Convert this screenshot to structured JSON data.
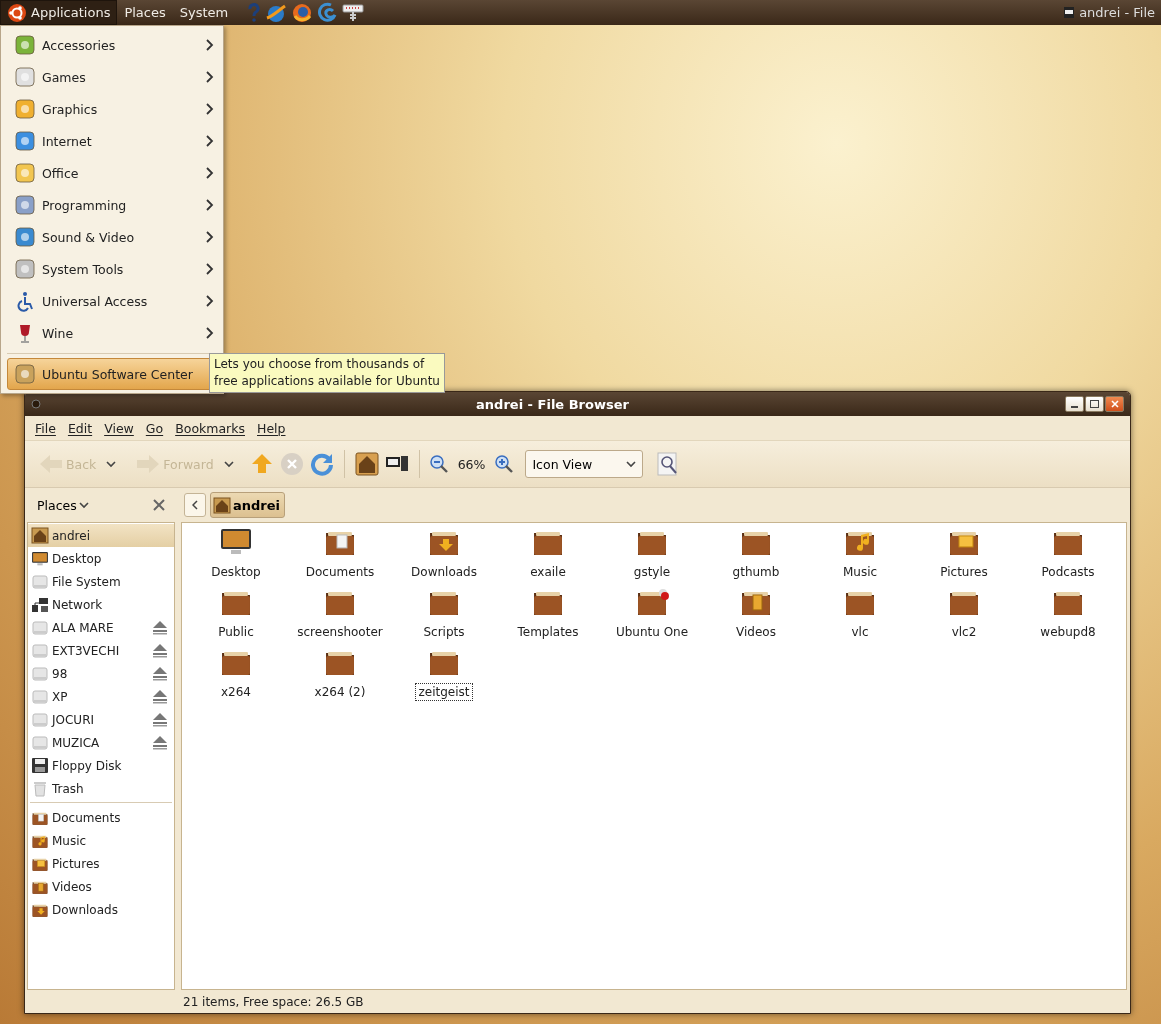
{
  "top_panel": {
    "menus": [
      {
        "label": "Applications",
        "selected": true
      },
      {
        "label": "Places",
        "selected": false
      },
      {
        "label": "System",
        "selected": false
      }
    ],
    "window_button": {
      "label": "andrei - File"
    }
  },
  "applications_menu": {
    "items": [
      {
        "label": "Accessories",
        "kind": "accessories",
        "submenu": true,
        "selected": false
      },
      {
        "label": "Games",
        "kind": "games",
        "submenu": true,
        "selected": false
      },
      {
        "label": "Graphics",
        "kind": "graphics",
        "submenu": true,
        "selected": false
      },
      {
        "label": "Internet",
        "kind": "internet",
        "submenu": true,
        "selected": false
      },
      {
        "label": "Office",
        "kind": "office",
        "submenu": true,
        "selected": false
      },
      {
        "label": "Programming",
        "kind": "programming",
        "submenu": true,
        "selected": false
      },
      {
        "label": "Sound & Video",
        "kind": "sound",
        "submenu": true,
        "selected": false
      },
      {
        "label": "System Tools",
        "kind": "tools",
        "submenu": true,
        "selected": false
      },
      {
        "label": "Universal Access",
        "kind": "access",
        "submenu": true,
        "selected": false
      },
      {
        "label": "Wine",
        "kind": "wine",
        "submenu": true,
        "selected": false
      }
    ],
    "footer_items": [
      {
        "label": "Ubuntu Software Center",
        "kind": "software",
        "submenu": false,
        "selected": true
      }
    ],
    "tooltip": "Lets you choose from thousands of\nfree applications available for Ubuntu"
  },
  "window": {
    "title": "andrei - File Browser",
    "menubar": [
      "File",
      "Edit",
      "View",
      "Go",
      "Bookmarks",
      "Help"
    ],
    "toolbar": {
      "back": {
        "label": "Back",
        "disabled": true
      },
      "forward": {
        "label": "Forward",
        "disabled": true
      },
      "zoom": "66%",
      "view": "Icon View"
    },
    "sidebar": {
      "header": "Places",
      "places": [
        {
          "label": "andrei",
          "kind": "home",
          "ejectable": false,
          "selected": true
        },
        {
          "label": "Desktop",
          "kind": "desktop",
          "ejectable": false,
          "selected": false
        },
        {
          "label": "File System",
          "kind": "drive",
          "ejectable": false,
          "selected": false
        },
        {
          "label": "Network",
          "kind": "network",
          "ejectable": false,
          "selected": false
        },
        {
          "label": "ALA MARE",
          "kind": "drive",
          "ejectable": true,
          "selected": false
        },
        {
          "label": "EXT3VECHI",
          "kind": "drive",
          "ejectable": true,
          "selected": false
        },
        {
          "label": "98",
          "kind": "drive",
          "ejectable": true,
          "selected": false
        },
        {
          "label": "XP",
          "kind": "drive",
          "ejectable": true,
          "selected": false
        },
        {
          "label": "JOCURI",
          "kind": "drive",
          "ejectable": true,
          "selected": false
        },
        {
          "label": "MUZICA",
          "kind": "drive",
          "ejectable": true,
          "selected": false
        },
        {
          "label": "Floppy Disk",
          "kind": "floppy",
          "ejectable": false,
          "selected": false
        },
        {
          "label": "Trash",
          "kind": "trash",
          "ejectable": false,
          "selected": false
        }
      ],
      "bookmarks": [
        {
          "label": "Documents",
          "kind": "documents",
          "ejectable": false,
          "selected": false
        },
        {
          "label": "Music",
          "kind": "music",
          "ejectable": false,
          "selected": false
        },
        {
          "label": "Pictures",
          "kind": "pictures",
          "ejectable": false,
          "selected": false
        },
        {
          "label": "Videos",
          "kind": "videos",
          "ejectable": false,
          "selected": false
        },
        {
          "label": "Downloads",
          "kind": "downloads",
          "ejectable": false,
          "selected": false
        }
      ]
    },
    "location": {
      "label": "andrei"
    },
    "files": [
      {
        "name": "Desktop",
        "kind": "desktop",
        "focused": false
      },
      {
        "name": "Documents",
        "kind": "documents",
        "focused": false
      },
      {
        "name": "Downloads",
        "kind": "downloads",
        "focused": false
      },
      {
        "name": "exaile",
        "kind": "folder",
        "focused": false
      },
      {
        "name": "gstyle",
        "kind": "folder",
        "focused": false
      },
      {
        "name": "gthumb",
        "kind": "folder",
        "focused": false
      },
      {
        "name": "Music",
        "kind": "music",
        "focused": false
      },
      {
        "name": "Pictures",
        "kind": "pictures",
        "focused": false
      },
      {
        "name": "Podcasts",
        "kind": "folder",
        "focused": false
      },
      {
        "name": "Public",
        "kind": "folder",
        "focused": false
      },
      {
        "name": "screenshooter",
        "kind": "folder",
        "focused": false
      },
      {
        "name": "Scripts",
        "kind": "folder",
        "focused": false
      },
      {
        "name": "Templates",
        "kind": "folder",
        "focused": false
      },
      {
        "name": "Ubuntu One",
        "kind": "ubuntu-one",
        "focused": false
      },
      {
        "name": "Videos",
        "kind": "videos",
        "focused": false
      },
      {
        "name": "vlc",
        "kind": "folder",
        "focused": false
      },
      {
        "name": "vlc2",
        "kind": "folder",
        "focused": false
      },
      {
        "name": "webupd8",
        "kind": "folder",
        "focused": false
      },
      {
        "name": "x264",
        "kind": "folder",
        "focused": false
      },
      {
        "name": "x264 (2)",
        "kind": "folder",
        "focused": false
      },
      {
        "name": "zeitgeist",
        "kind": "folder",
        "focused": true
      }
    ],
    "status": "21 items, Free space: 26.5 GB"
  }
}
